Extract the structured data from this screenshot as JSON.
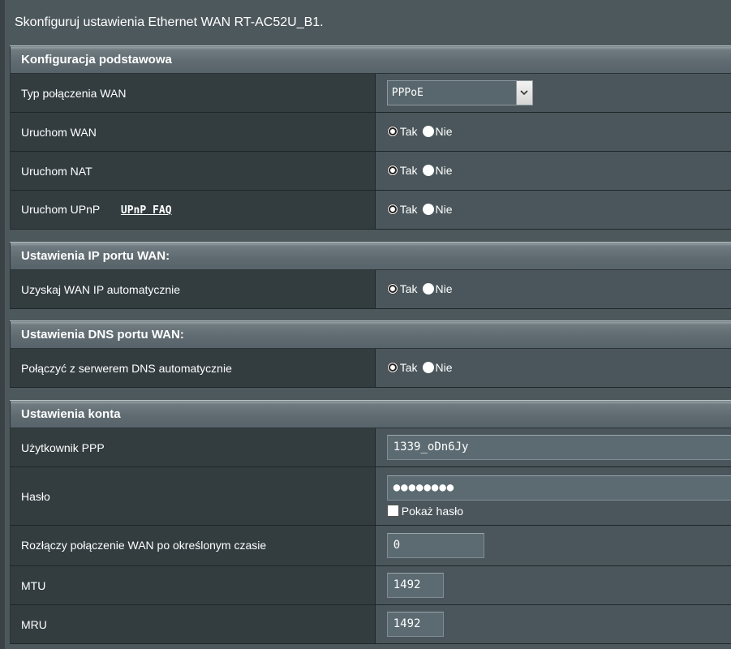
{
  "page": {
    "title": "Skonfiguruj ustawienia Ethernet WAN RT-AC52U_B1."
  },
  "basic": {
    "header": "Konfiguracja podstawowa",
    "wan_type_label": "Typ połączenia WAN",
    "wan_type_value": "PPPoE",
    "enable_wan_label": "Uruchom WAN",
    "enable_nat_label": "Uruchom NAT",
    "enable_upnp_label": "Uruchom UPnP",
    "upnp_faq_link": "UPnP FAQ"
  },
  "radio_labels": {
    "yes": "Tak",
    "no": "Nie"
  },
  "wan_ip": {
    "header": "Ustawienia IP portu WAN:",
    "auto_ip_label": "Uzyskaj WAN IP automatycznie"
  },
  "wan_dns": {
    "header": "Ustawienia DNS portu WAN:",
    "auto_dns_label": "Połączyć z serwerem DNS automatycznie"
  },
  "account": {
    "header": "Ustawienia konta",
    "user_label": "Użytkownik PPP",
    "user_value": "1339_oDn6Jy",
    "password_label": "Hasło",
    "password_value": "●●●●●●●●",
    "show_password_label": "Pokaż hasło",
    "idle_label": "Rozłączy połączenie WAN po określonym czasie",
    "idle_value": "0",
    "mtu_label": "MTU",
    "mtu_value": "1492",
    "mru_label": "MRU",
    "mru_value": "1492"
  },
  "selections": {
    "enable_wan": "yes",
    "enable_nat": "yes",
    "enable_upnp": "yes",
    "auto_ip": "yes",
    "auto_dns": "yes",
    "show_password": false
  },
  "colors": {
    "background": "#4d585d",
    "label_cell": "#333d40",
    "value_cell": "#4a565b",
    "header_bar": "#5f6b70"
  }
}
